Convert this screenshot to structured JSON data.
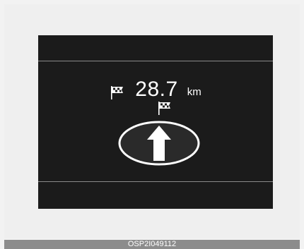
{
  "navigation": {
    "distance_value": "28.7",
    "distance_unit": "km",
    "destination_icon": "checkered-flag-icon",
    "waypoint_icon": "checkered-flag-icon",
    "direction_icon": "straight-arrow-icon"
  },
  "caption": "OSP2I049112",
  "colors": {
    "display_background": "#1b1b1b",
    "divider": "#8a8a8a",
    "caption_bar": "#8c8c8c",
    "page_background": "#efefef"
  }
}
